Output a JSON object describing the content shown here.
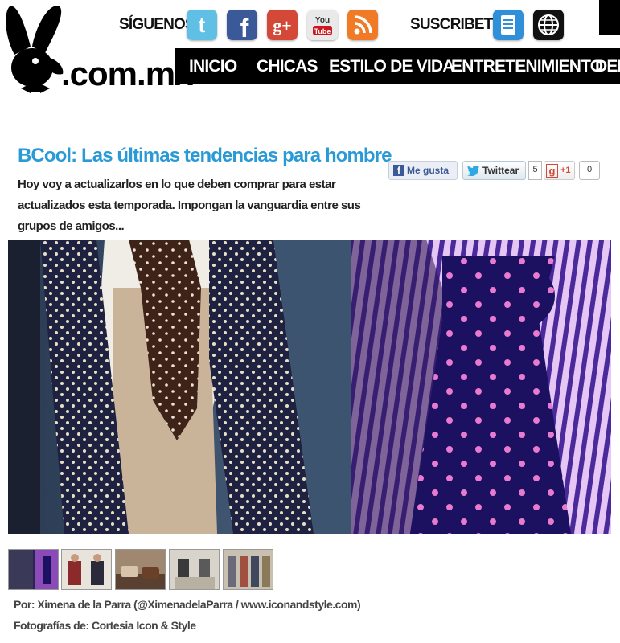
{
  "header": {
    "logo_text": ".com.mx",
    "follow_label": "SÍGUENOS:",
    "subscribe_label": "SUSCRIBETE:",
    "social_icons": [
      {
        "name": "twitter-icon",
        "glyph": "t",
        "color": "#5fbfe4"
      },
      {
        "name": "facebook-icon",
        "glyph": "f",
        "color": "#3b5998"
      },
      {
        "name": "google-plus-icon",
        "glyph": "g+",
        "color": "#d34836"
      },
      {
        "name": "youtube-icon",
        "glyph": "You Tube",
        "color": "#e9e9e9"
      },
      {
        "name": "rss-icon",
        "glyph": "rss",
        "color": "#f07a25"
      }
    ],
    "subscribe_icons": [
      {
        "name": "newsletter-icon",
        "color": "#2f8fd8"
      },
      {
        "name": "globe-icon",
        "color": "#111111"
      }
    ]
  },
  "nav": {
    "items": [
      "INICIO",
      "CHICAS",
      "ESTILO DE VIDA",
      "ENTRETENIMIENTO",
      "DEP"
    ]
  },
  "article": {
    "title": "BCool: Las últimas tendencias para hombre",
    "description": "Hoy voy a actualizarlos en lo que deben comprar para estar actualizados esta temporada. Impongan la vanguardia entre sus grupos de amigos...",
    "credit_author": "Por: Ximena de la Parra (@XimenadelaParra / www.iconandstyle.com)",
    "credit_photos": "Fotografías de: Cortesia Icon & Style"
  },
  "share": {
    "like_label": "Me gusta",
    "tweet_label": "Twittear",
    "tweet_count": "5",
    "gplus_label": "+1",
    "gplus_count": "0"
  },
  "gallery": {
    "thumbnail_count": 5
  },
  "colors": {
    "title": "#2a9ad6",
    "nav_bg": "#000000",
    "like_text": "#3b5998"
  }
}
